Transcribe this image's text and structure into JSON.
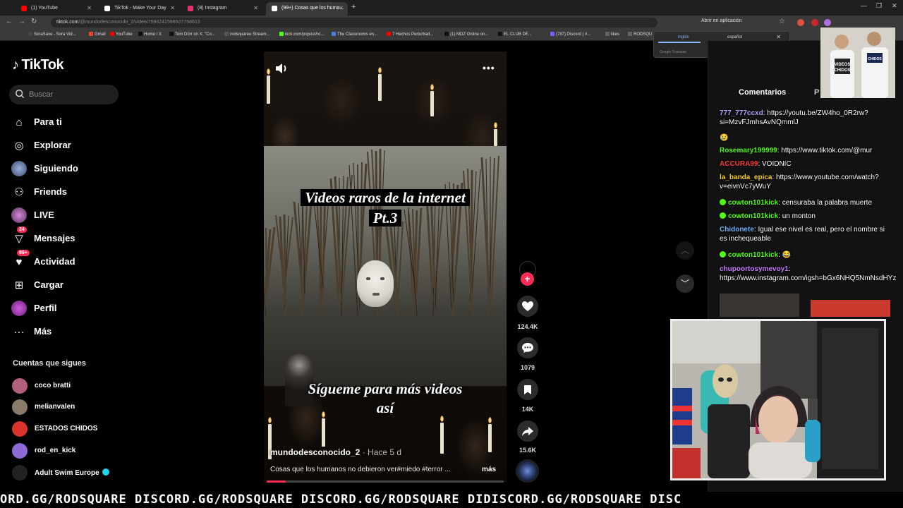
{
  "browser": {
    "tabs": [
      {
        "label": "(1) YouTube",
        "color": "#ff0000",
        "active": false
      },
      {
        "label": "TikTok - Make Your Day",
        "color": "#ffffff",
        "active": false
      },
      {
        "label": "(8) Instagram",
        "color": "#e1306c",
        "active": false
      },
      {
        "label": "(99+) Cosas que los huma...",
        "color": "#ffffff",
        "active": true
      }
    ],
    "url_host": "tiktok.com",
    "url_path": "/@mundodesconocido_2/video/7593241596527758613",
    "open_in_app": "Abrir en aplicación",
    "bookmarks": [
      "SoraSave - Sora Vid...",
      "Gmail",
      "YouTube",
      "Home / X",
      "Tom Dörr on X: \"Co...",
      "rodsquaree Stream...",
      "kick.com/popout/ro...",
      "The Classrooms en...",
      "7 Hechos Perturbad...",
      "(1) MDZ Online on...",
      "EL CLUB DE...",
      "(787) Discord | #...",
      "likes",
      "RODSQU"
    ]
  },
  "translate_popup": {
    "from_lang": "inglés",
    "to_lang": "español",
    "credit": "Google Translate"
  },
  "tiktok": {
    "logo": "TikTok",
    "search_placeholder": "Buscar",
    "nav": [
      {
        "label": "Para ti",
        "icon": "home-icon"
      },
      {
        "label": "Explorar",
        "icon": "compass-icon"
      },
      {
        "label": "Siguiendo",
        "icon": "following-avatar-icon"
      },
      {
        "label": "Friends",
        "icon": "friends-icon"
      },
      {
        "label": "LIVE",
        "icon": "live-avatar-icon"
      },
      {
        "label": "Mensajes",
        "icon": "messages-icon",
        "badge": "24"
      },
      {
        "label": "Actividad",
        "icon": "activity-icon",
        "badge": "99+"
      },
      {
        "label": "Cargar",
        "icon": "upload-icon"
      },
      {
        "label": "Perfil",
        "icon": "profile-icon"
      },
      {
        "label": "Más",
        "icon": "more-dots-icon"
      }
    ],
    "following_title": "Cuentas que sigues",
    "following": [
      {
        "name": "coco bratti",
        "color": "#b0607a"
      },
      {
        "name": "melianvalen",
        "color": "#8a7a6a"
      },
      {
        "name": "ESTADOS CHIDOS",
        "color": "#d9332b"
      },
      {
        "name": "rod_en_kick",
        "color": "#8e6ad8"
      },
      {
        "name": "Adult Swim Europe",
        "color": "#222222",
        "verified": true
      }
    ]
  },
  "video": {
    "title_line1": "Videos raros de la internet",
    "title_line2": "Pt.3",
    "follow_line1": "Sígueme para más videos",
    "follow_line2": "así",
    "author": "mundodesconocido_2",
    "time_ago": "Hace 5 d",
    "description": "Cosas que los humanos no debieron ver#miedo #terror ...",
    "more_label": "más",
    "progress": 0.08
  },
  "actions": {
    "likes": "124.4K",
    "comments": "1079",
    "saves": "14K",
    "shares": "15.6K"
  },
  "right_panel": {
    "tab_comments": "Comentarios",
    "tab_other": "P"
  },
  "chat": [
    {
      "user": "777_777ccxd",
      "color": "#b99cff",
      "text": "https://youtu.be/ZW4ho_0R2rw?si=MzvFJmhsAvNQmmlJ"
    },
    {
      "user": "",
      "color": "#ffffff",
      "text": "😢"
    },
    {
      "user": "Rosemary199999",
      "color": "#53fc18",
      "text": "https://www.tiktok.com/@mur"
    },
    {
      "user": "ACCURA99",
      "color": "#ff3b3b",
      "text": "VOIDNIC"
    },
    {
      "user": "la_banda_epica",
      "color": "#f5d020",
      "text": "https://www.youtube.com/watch?v=eivnVc7yWuY"
    },
    {
      "user": "cowton101kick",
      "color": "#53fc18",
      "text": "censuraba la palabra muerte",
      "kick": true
    },
    {
      "user": "cowton101kick",
      "color": "#53fc18",
      "text": "un monton",
      "kick": true
    },
    {
      "user": "Chidonete",
      "color": "#6fb6ff",
      "text": "Igual ese nivel es real, pero el nombre si es inchequeable"
    },
    {
      "user": "cowton101kick",
      "color": "#53fc18",
      "text": "😂",
      "kick": true
    },
    {
      "user": "chupoortosymevoy1",
      "color": "#c77dff",
      "text": "https://www.instagram.com/igsh=bGx6NHQ5NmNsdHYz"
    }
  ],
  "ticker_text": "ORD.GG/RODSQUARE DISCORD.GG/RODSQUARE DISCORD.GG/RODSQUARE DIDISCORD.GG/RODSQUARE DISC",
  "colors": {
    "accent": "#fe2c55",
    "kick_green": "#53fc18",
    "verified": "#20d5ec"
  }
}
